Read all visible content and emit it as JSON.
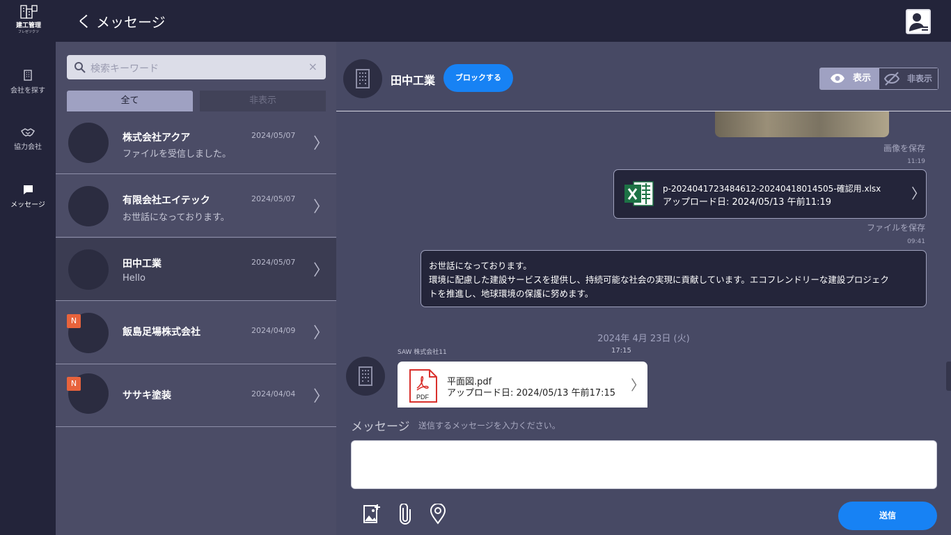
{
  "app": {
    "logo_text": "建工管理",
    "logo_sub": "フレゼツクツ",
    "back_glyph": "く",
    "title": "メッセージ"
  },
  "nav": {
    "items": [
      {
        "label": "会社を探す",
        "icon": "building-icon"
      },
      {
        "label": "協力会社",
        "icon": "handshake-icon"
      },
      {
        "label": "メッセージ",
        "icon": "chat-icon",
        "active": true
      }
    ]
  },
  "list": {
    "search_placeholder": "検索キーワード",
    "clear_glyph": "×",
    "tabs": [
      {
        "label": "全て",
        "selected": true
      },
      {
        "label": "非表示",
        "selected": false
      }
    ],
    "conversations": [
      {
        "name": "株式会社アクア",
        "preview": "ファイルを受信しました。",
        "date": "2024/05/07",
        "badge": ""
      },
      {
        "name": "有限会社エイテック",
        "preview": "お世話になっております。",
        "date": "2024/05/07",
        "badge": ""
      },
      {
        "name": "田中工業",
        "preview": "Hello",
        "date": "2024/05/07",
        "badge": "",
        "active": true
      },
      {
        "name": "飯島足場株式会社",
        "preview": "",
        "date": "2024/04/09",
        "badge": "N"
      },
      {
        "name": "ササキ塗装",
        "preview": "",
        "date": "2024/04/04",
        "badge": "N"
      }
    ],
    "chevron": "〉"
  },
  "chat": {
    "company": "田中工業",
    "block_label": "ブロックする",
    "toggle_show": "表示",
    "toggle_hide": "非表示",
    "save_image": "画像を保存",
    "time_1": "11:19",
    "file_name": "p-2024041723484612-20240418014505-確認用.xlsx",
    "file_upload": "アップロード日: 2024/05/13 午前11:19",
    "save_file": "ファイルを保存",
    "time_2": "09:41",
    "message_lines": [
      "お世話になっております。",
      "環境に配慮した建設サービスを提供し、持続可能な社会の実現に貢献しています。エコフレンドリーな建設プロジェク",
      "トを推進し、地球環境の保護に努めます。"
    ],
    "date_separator": "2024年 4月 23日 (火)",
    "sender": "SAW 株式会社11",
    "sender_time": "17:15",
    "pdf_name": "平面図.pdf",
    "pdf_upload": "アップロード日: 2024/05/13 午前17:15",
    "pdf_label": "PDF",
    "compose_label": "メッセージ",
    "compose_hint": "送信するメッセージを入力ください。",
    "send_label": "送信"
  },
  "colors": {
    "accent_blue": "#1782f4",
    "badge_orange": "#e8633c",
    "excel_green": "#1d7245",
    "pdf_red": "#d9302c"
  }
}
